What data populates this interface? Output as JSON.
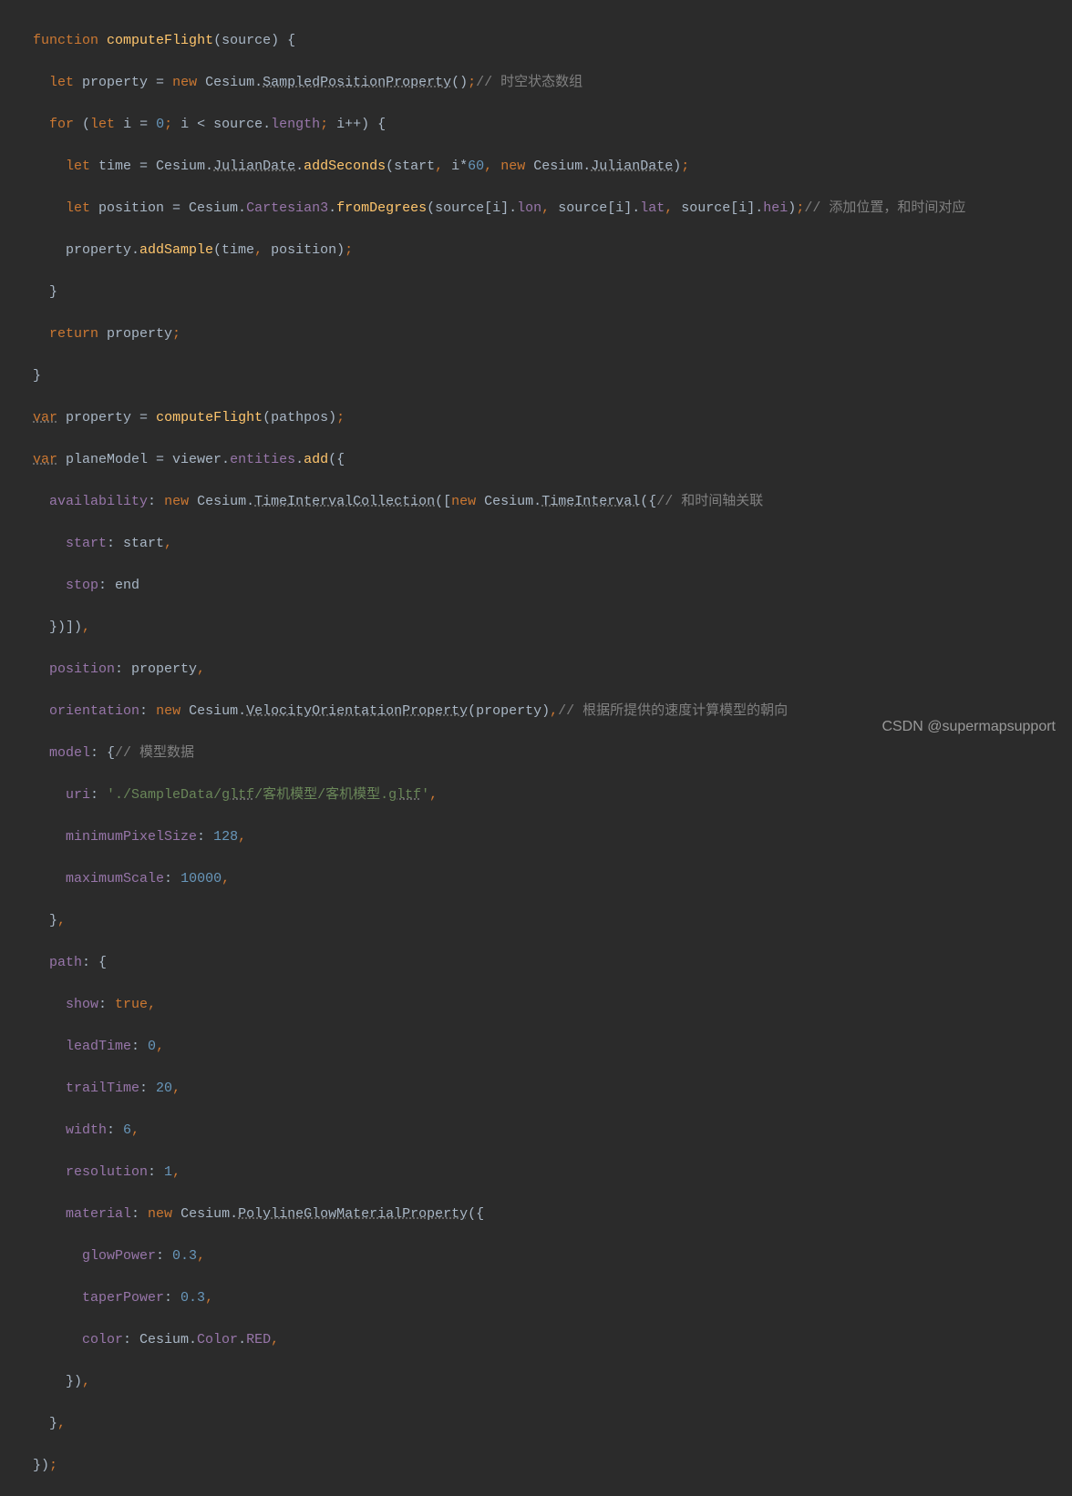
{
  "code": {
    "line1": {
      "kw1": "function",
      "fn": "computeFlight",
      "p1": "(source) {"
    },
    "line2": {
      "kw1": "let",
      "t1": " property = ",
      "kw2": "new",
      "t2": " Cesium.",
      "u1": "SampledPositionProperty",
      "t3": "()",
      "pun": ";",
      "com": "// 时空状态数组"
    },
    "line3": {
      "kw1": "for",
      "t1": " (",
      "kw2": "let",
      "t2": " i = ",
      "num": "0",
      "pun1": ";",
      "t3": " i < source.",
      "prop": "length",
      "pun2": ";",
      "t4": " i++) {"
    },
    "line4": {
      "kw1": "let",
      "t1": " time = Cesium.",
      "u1": "JulianDate",
      "t2": ".",
      "fn": "addSeconds",
      "t3": "(start",
      "pun1": ",",
      "t4": " i*",
      "num": "60",
      "pun2": ",",
      "t5": " ",
      "kw2": "new",
      "t6": " Cesium.",
      "u2": "JulianDate",
      "t7": ")",
      "pun3": ";"
    },
    "line5": {
      "kw1": "let",
      "t1": " position = Cesium.",
      "prop1": "Cartesian3",
      "t2": ".",
      "fn": "fromDegrees",
      "t3": "(source[i].",
      "prop2": "lon",
      "pun1": ",",
      "t4": " source[i].",
      "prop3": "lat",
      "pun2": ",",
      "t5": " source[i].",
      "prop4": "hei",
      "t6": ")",
      "pun3": ";",
      "com": "// 添加位置，和时间对应"
    },
    "line6": {
      "t1": "property.",
      "fn": "addSample",
      "t2": "(time",
      "pun1": ",",
      "t3": " position)",
      "pun2": ";"
    },
    "line7": {
      "t": "}"
    },
    "line8": {
      "kw1": "return",
      "t": " property",
      "pun": ";"
    },
    "line9": {
      "t": "}"
    },
    "line10": {
      "kw1": "var",
      "t1": " property = ",
      "fn": "computeFlight",
      "t2": "(pathpos)",
      "pun": ";"
    },
    "line11": {
      "kw1": "var",
      "t1": " planeModel = viewer.",
      "prop": "entities",
      "t2": ".",
      "fn": "add",
      "t3": "({"
    },
    "line12": {
      "prop1": "availability",
      "t1": ": ",
      "kw1": "new",
      "t2": " Cesium.",
      "u1": "TimeIntervalCollection",
      "t3": "([",
      "kw2": "new",
      "t4": " Cesium.",
      "u2": "TimeInterval",
      "t5": "({",
      "com": "// 和时间轴关联"
    },
    "line13": {
      "prop": "start",
      "t": ": start",
      "pun": ","
    },
    "line14": {
      "prop": "stop",
      "t": ": end"
    },
    "line15": {
      "t": "})])",
      "pun": ","
    },
    "line16": {
      "prop": "position",
      "t": ": property",
      "pun": ","
    },
    "line17": {
      "prop": "orientation",
      "t1": ": ",
      "kw": "new",
      "t2": " Cesium.",
      "u": "VelocityOrientationProperty",
      "t3": "(property)",
      "pun": ",",
      "com": "// 根据所提供的速度计算模型的朝向"
    },
    "line18": {
      "prop": "model",
      "t": ": {",
      "com": "// 模型数据"
    },
    "line19": {
      "prop": "uri",
      "t1": ": ",
      "str1": "'./SampleData/",
      "stru1": "gltf",
      "str2": "/客机模型/客机模型.",
      "stru2": "gltf",
      "str3": "'",
      "pun": ","
    },
    "line20": {
      "prop": "minimumPixelSize",
      "t": ": ",
      "num": "128",
      "pun": ","
    },
    "line21": {
      "prop": "maximumScale",
      "t": ": ",
      "num": "10000",
      "pun": ","
    },
    "line22": {
      "t": "}",
      "pun": ","
    },
    "line23": {
      "prop": "path",
      "t": ": {"
    },
    "line24": {
      "prop": "show",
      "t": ": ",
      "kw": "true",
      "pun": ","
    },
    "line25": {
      "prop": "leadTime",
      "t": ": ",
      "num": "0",
      "pun": ","
    },
    "line26": {
      "prop": "trailTime",
      "t": ": ",
      "num": "20",
      "pun": ","
    },
    "line27": {
      "prop": "width",
      "t": ": ",
      "num": "6",
      "pun": ","
    },
    "line28": {
      "prop": "resolution",
      "t": ": ",
      "num": "1",
      "pun": ","
    },
    "line29": {
      "prop": "material",
      "t1": ": ",
      "kw": "new",
      "t2": " Cesium.",
      "u": "PolylineGlowMaterialProperty",
      "t3": "({"
    },
    "line30": {
      "prop": "glowPower",
      "t": ": ",
      "num": "0.3",
      "pun": ","
    },
    "line31": {
      "prop": "taperPower",
      "t": ": ",
      "num": "0.3",
      "pun": ","
    },
    "line32": {
      "prop": "color",
      "t1": ": Cesium.",
      "prop2": "Color",
      "t2": ".",
      "prop3": "RED",
      "pun": ","
    },
    "line33": {
      "t": "})",
      "pun": ","
    },
    "line34": {
      "t": "}",
      "pun": ","
    },
    "line35": {
      "t": "})",
      "pun": ";"
    }
  },
  "watermark": "CSDN @supermapsupport"
}
